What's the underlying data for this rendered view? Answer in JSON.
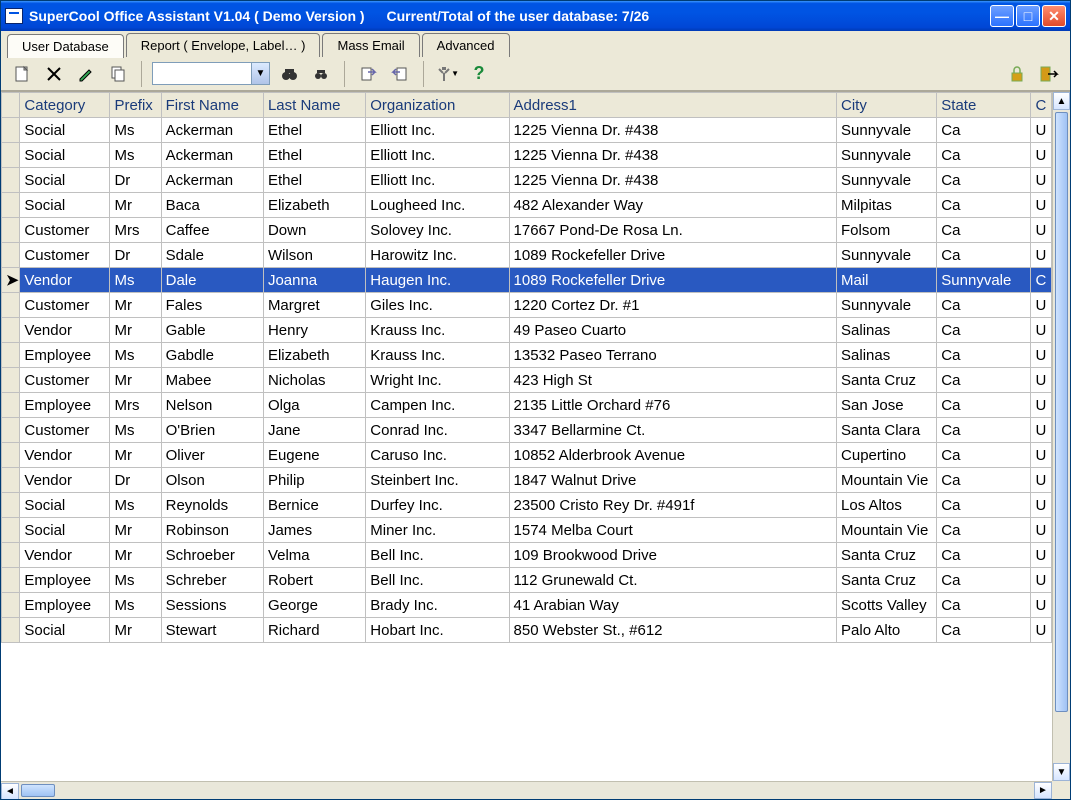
{
  "title": {
    "app": "SuperCool Office Assistant V1.04  ( Demo Version )",
    "counter_label": "Current/Total of the user database:",
    "counter_value": "7/26"
  },
  "tabs": [
    {
      "label": "User Database",
      "active": true
    },
    {
      "label": "Report ( Envelope, Label… )",
      "active": false
    },
    {
      "label": "Mass Email",
      "active": false
    },
    {
      "label": "Advanced",
      "active": false
    }
  ],
  "toolbar": {
    "new": "new-document-icon",
    "delete": "delete-icon",
    "edit": "edit-icon",
    "copy": "copy-icon",
    "filter_value": "",
    "find": "find-icon",
    "findnext": "find-next-icon",
    "import": "import-icon",
    "export": "export-icon",
    "tools": "tools-icon",
    "help": "help-icon",
    "lock": "lock-icon",
    "exit": "exit-icon"
  },
  "columns": [
    "Category",
    "Prefix",
    "First Name",
    "Last Name",
    "Organization",
    "Address1",
    "City",
    "State",
    "C"
  ],
  "rows": [
    {
      "Category": "Social",
      "Prefix": "Ms",
      "First Name": "Ackerman",
      "Last Name": "Ethel",
      "Organization": "Elliott Inc.",
      "Address1": "1225 Vienna Dr. #438",
      "City": "Sunnyvale",
      "State": "Ca",
      "C": "U"
    },
    {
      "Category": "Social",
      "Prefix": "Ms",
      "First Name": "Ackerman",
      "Last Name": "Ethel",
      "Organization": "Elliott Inc.",
      "Address1": "1225 Vienna Dr. #438",
      "City": "Sunnyvale",
      "State": "Ca",
      "C": "U"
    },
    {
      "Category": "Social",
      "Prefix": "Dr",
      "First Name": "Ackerman",
      "Last Name": "Ethel",
      "Organization": "Elliott Inc.",
      "Address1": "1225 Vienna Dr. #438",
      "City": "Sunnyvale",
      "State": "Ca",
      "C": "U"
    },
    {
      "Category": "Social",
      "Prefix": "Mr",
      "First Name": "Baca",
      "Last Name": "Elizabeth",
      "Organization": "Lougheed Inc.",
      "Address1": "482 Alexander Way",
      "City": "Milpitas",
      "State": "Ca",
      "C": "U"
    },
    {
      "Category": "Customer",
      "Prefix": "Mrs",
      "First Name": "Caffee",
      "Last Name": "Down",
      "Organization": "Solovey Inc.",
      "Address1": "17667 Pond-De Rosa Ln.",
      "City": "Folsom",
      "State": "Ca",
      "C": "U"
    },
    {
      "Category": "Customer",
      "Prefix": "Dr",
      "First Name": "Sdale",
      "Last Name": "Wilson",
      "Organization": "Harowitz Inc.",
      "Address1": "1089 Rockefeller Drive",
      "City": "Sunnyvale",
      "State": "Ca",
      "C": "U"
    },
    {
      "Category": "Vendor",
      "Prefix": "Ms",
      "First Name": "Dale",
      "Last Name": "Joanna",
      "Organization": "Haugen Inc.",
      "Address1": "1089 Rockefeller Drive",
      "City": "Mail",
      "State": "Sunnyvale",
      "C": "C",
      "selected": true
    },
    {
      "Category": "Customer",
      "Prefix": "Mr",
      "First Name": "Fales",
      "Last Name": "Margret",
      "Organization": "Giles Inc.",
      "Address1": "1220 Cortez Dr. #1",
      "City": "Sunnyvale",
      "State": "Ca",
      "C": "U"
    },
    {
      "Category": "Vendor",
      "Prefix": "Mr",
      "First Name": "Gable",
      "Last Name": "Henry",
      "Organization": "Krauss Inc.",
      "Address1": "49 Paseo Cuarto",
      "City": "Salinas",
      "State": "Ca",
      "C": "U"
    },
    {
      "Category": "Employee",
      "Prefix": "Ms",
      "First Name": "Gabdle",
      "Last Name": "Elizabeth",
      "Organization": "Krauss Inc.",
      "Address1": "13532 Paseo Terrano",
      "City": "Salinas",
      "State": "Ca",
      "C": "U"
    },
    {
      "Category": "Customer",
      "Prefix": "Mr",
      "First Name": "Mabee",
      "Last Name": "Nicholas",
      "Organization": "Wright Inc.",
      "Address1": "423 High St",
      "City": "Santa Cruz",
      "State": "Ca",
      "C": "U"
    },
    {
      "Category": "Employee",
      "Prefix": "Mrs",
      "First Name": "Nelson",
      "Last Name": "Olga",
      "Organization": "Campen Inc.",
      "Address1": "2135 Little Orchard #76",
      "City": "San Jose",
      "State": "Ca",
      "C": "U"
    },
    {
      "Category": "Customer",
      "Prefix": "Ms",
      "First Name": "O'Brien",
      "Last Name": "Jane",
      "Organization": "Conrad Inc.",
      "Address1": "3347 Bellarmine Ct.",
      "City": "Santa Clara",
      "State": "Ca",
      "C": "U"
    },
    {
      "Category": "Vendor",
      "Prefix": "Mr",
      "First Name": "Oliver",
      "Last Name": "Eugene",
      "Organization": "Caruso Inc.",
      "Address1": "10852 Alderbrook Avenue",
      "City": "Cupertino",
      "State": "Ca",
      "C": "U"
    },
    {
      "Category": "Vendor",
      "Prefix": "Dr",
      "First Name": "Olson",
      "Last Name": "Philip",
      "Organization": "Steinbert Inc.",
      "Address1": "1847 Walnut Drive",
      "City": "Mountain Vie",
      "State": "Ca",
      "C": "U"
    },
    {
      "Category": "Social",
      "Prefix": "Ms",
      "First Name": "Reynolds",
      "Last Name": "Bernice",
      "Organization": "Durfey Inc.",
      "Address1": "23500 Cristo Rey Dr. #491f",
      "City": "Los Altos",
      "State": "Ca",
      "C": "U"
    },
    {
      "Category": "Social",
      "Prefix": "Mr",
      "First Name": "Robinson",
      "Last Name": "James",
      "Organization": "Miner Inc.",
      "Address1": "1574 Melba Court",
      "City": "Mountain Vie",
      "State": "Ca",
      "C": "U"
    },
    {
      "Category": "Vendor",
      "Prefix": "Mr",
      "First Name": "Schroeber",
      "Last Name": "Velma",
      "Organization": "Bell Inc.",
      "Address1": "109 Brookwood Drive",
      "City": "Santa Cruz",
      "State": "Ca",
      "C": "U"
    },
    {
      "Category": "Employee",
      "Prefix": "Ms",
      "First Name": "Schreber",
      "Last Name": "Robert",
      "Organization": "Bell Inc.",
      "Address1": "112 Grunewald Ct.",
      "City": "Santa Cruz",
      "State": "Ca",
      "C": "U"
    },
    {
      "Category": "Employee",
      "Prefix": "Ms",
      "First Name": "Sessions",
      "Last Name": "George",
      "Organization": "Brady Inc.",
      "Address1": "41 Arabian Way",
      "City": "Scotts Valley",
      "State": "Ca",
      "C": "U"
    },
    {
      "Category": "Social",
      "Prefix": "Mr",
      "First Name": "Stewart",
      "Last Name": "Richard",
      "Organization": "Hobart Inc.",
      "Address1": "850 Webster St., #612",
      "City": "Palo Alto",
      "State": "Ca",
      "C": "U"
    }
  ]
}
